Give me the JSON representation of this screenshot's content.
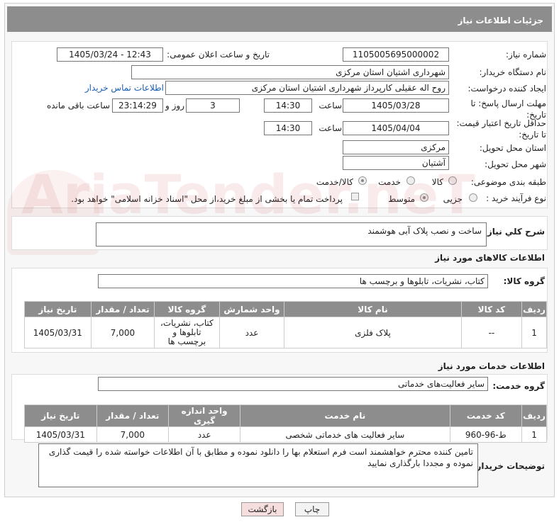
{
  "header": {
    "title": "جزئیات اطلاعات نیاز"
  },
  "form": {
    "need_number_label": "شماره نیاز:",
    "need_number": "1105005695000002",
    "announce_label": "تاریخ و ساعت اعلان عمومی:",
    "announce_value": "1405/03/24 - 12:43",
    "buyer_org_label": "نام دستگاه خریدار:",
    "buyer_org": "شهرداری اشتیان استان مرکزی",
    "creator_label": "ایجاد کننده درخواست:",
    "creator": "روح اله عقیلی کارپرداز شهرداری اشتیان استان مرکزی",
    "contact_link": "اطلاعات تماس خریدار",
    "deadline_label": "مهلت ارسال پاسخ: تا تاریخ:",
    "deadline_date": "1405/03/28",
    "time_word": "ساعت",
    "deadline_time": "14:30",
    "days_value": "3",
    "days_word": "روز و",
    "remaining_time": "23:14:29",
    "remaining_word": "ساعت باقی مانده",
    "price_validity_label": "حداقل تاریخ اعتبار قیمت: تا تاریخ:",
    "price_date": "1405/04/04",
    "price_time": "14:30",
    "province_label": "استان محل تحویل:",
    "province": "مرکزی",
    "city_label": "شهر محل تحویل:",
    "city": "آشتیان",
    "category_label": "طبقه بندی موضوعی:",
    "cat_options": [
      "کالا",
      "خدمت",
      "کالا/خدمت"
    ],
    "process_label": "نوع فرآیند خرید :",
    "process_options": [
      "جزیی",
      "متوسط"
    ],
    "payment_note": "پرداخت تمام یا بخشی از مبلغ خرید،از محل \"اسناد خزانه اسلامی\" خواهد بود."
  },
  "description": {
    "label": "شرح كلي نياز:",
    "value": "ساخت و نصب پلاک آبی هوشمند"
  },
  "goods": {
    "title": "اطلاعات کالاهای مورد نیاز",
    "group_label": "گروه کالا:",
    "group_value": "کتاب، نشریات، تابلوها و برچسب ها",
    "columns": [
      "ردیف",
      "کد کالا",
      "نام کالا",
      "واحد شمارش",
      "گروه کالا",
      "تعداد / مقدار",
      "تاریخ نیاز"
    ],
    "rows": [
      {
        "idx": "1",
        "code": "--",
        "name": "پلاک فلزی",
        "unit": "عدد",
        "group": "کتاب، نشریات، تابلوها و برچسب ها",
        "qty": "7,000",
        "date": "1405/03/31"
      }
    ]
  },
  "services": {
    "title": "اطلاعات خدمات مورد نیاز",
    "group_label": "گروه خدمت:",
    "group_value": "سایر فعالیت‌های خدماتی",
    "columns": [
      "ردیف",
      "کد خدمت",
      "نام خدمت",
      "واحد اندازه گیری",
      "تعداد / مقدار",
      "تاریخ نیاز"
    ],
    "rows": [
      {
        "idx": "1",
        "code": "ط-96-960",
        "name": "سایر فعالیت های خدماتی شخصی",
        "unit": "عدد",
        "qty": "7,000",
        "date": "1405/03/31"
      }
    ]
  },
  "buyer_notes": {
    "label": "توضیحات خریدار:",
    "value": "تامین کننده محترم خواهشمند است فرم استعلام بها را دانلود نموده و مطابق با آن اطلاعات خواسته شده را قیمت گذاری نموده و مجددا بارگذاری نمایید"
  },
  "buttons": {
    "print": "چاپ",
    "back": "بازگشت"
  },
  "watermark": "AriaTender.neT",
  "colors": {
    "header_bg": "#8d8d8d",
    "link": "#1a5fb4",
    "back_btn": "#f7dede"
  }
}
